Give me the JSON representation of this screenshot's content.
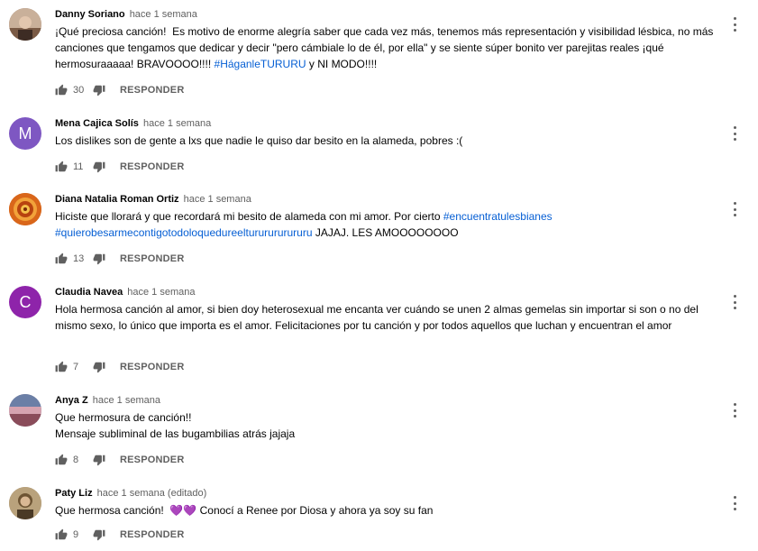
{
  "comments": [
    {
      "author": "Danny Soriano",
      "time": "hace 1 semana",
      "text_before": "¡Qué preciosa canción!  Es motivo de enorme alegría saber que cada vez más, tenemos más representación y visibilidad lésbica, no más canciones que tengamos que dedicar y decir \"pero cámbiale lo de él, por ella\" y se siente súper bonito ver parejitas reales ¡qué hermosuraaaaa! BRAVOOOO!!!! ",
      "hashtags": "#HáganleTURURU",
      "text_after": " y NI MODO!!!!",
      "likes": "30",
      "reply": "RESPONDER",
      "avatar": "photo"
    },
    {
      "author": "Mena Cajica Solís",
      "time": "hace 1 semana",
      "text_before": "Los dislikes son de gente a lxs que nadie le quiso dar besito en la alameda, pobres :(",
      "likes": "11",
      "reply": "RESPONDER",
      "avatar_letter": "M",
      "avatar_color": "#7e57c2"
    },
    {
      "author": "Diana Natalia Roman Ortiz",
      "time": "hace 1 semana",
      "text_before": "Hiciste que llorará y que recordará mi besito de alameda con mi amor. Por cierto ",
      "hashtags": "#encuentratulesbianes\n#quierobesarmecontigotodoloquedureeltururururururu",
      "text_after": " JAJAJ. LES AMOOOOOOOO",
      "likes": "13",
      "reply": "RESPONDER",
      "avatar": "mandala"
    },
    {
      "author": "Claudia Navea",
      "time": "hace 1 semana",
      "text_before": "Hola hermosa canción al amor, si bien doy heterosexual me encanta ver cuándo se unen 2 almas gemelas sin importar si son o no del mismo sexo, lo único que importa es el amor. Felicitaciones por tu canción y por todos aquellos que luchan y encuentran el amor",
      "likes": "7",
      "reply": "RESPONDER",
      "avatar_letter": "C",
      "avatar_color": "#8e24aa"
    },
    {
      "author": "Anya Z",
      "time": "hace 1 semana",
      "text_before": "Que hermosura de canción!!\nMensaje subliminal de las bugambilias atrás jajaja",
      "likes": "8",
      "reply": "RESPONDER",
      "avatar": "sunset"
    },
    {
      "author": "Paty Liz",
      "time": "hace 1 semana (editado)",
      "text_before": "Que hermosa canción!  💜💜 Conocí a Renee por Diosa y ahora ya soy su fan",
      "likes": "9",
      "reply": "RESPONDER",
      "avatar": "portrait"
    }
  ],
  "colors": {
    "hashtag": "#065fd4",
    "muted": "#606060",
    "text": "#030303"
  },
  "icons": {
    "like": "thumb-up-icon",
    "dislike": "thumb-down-icon",
    "menu": "more-vert-icon"
  }
}
